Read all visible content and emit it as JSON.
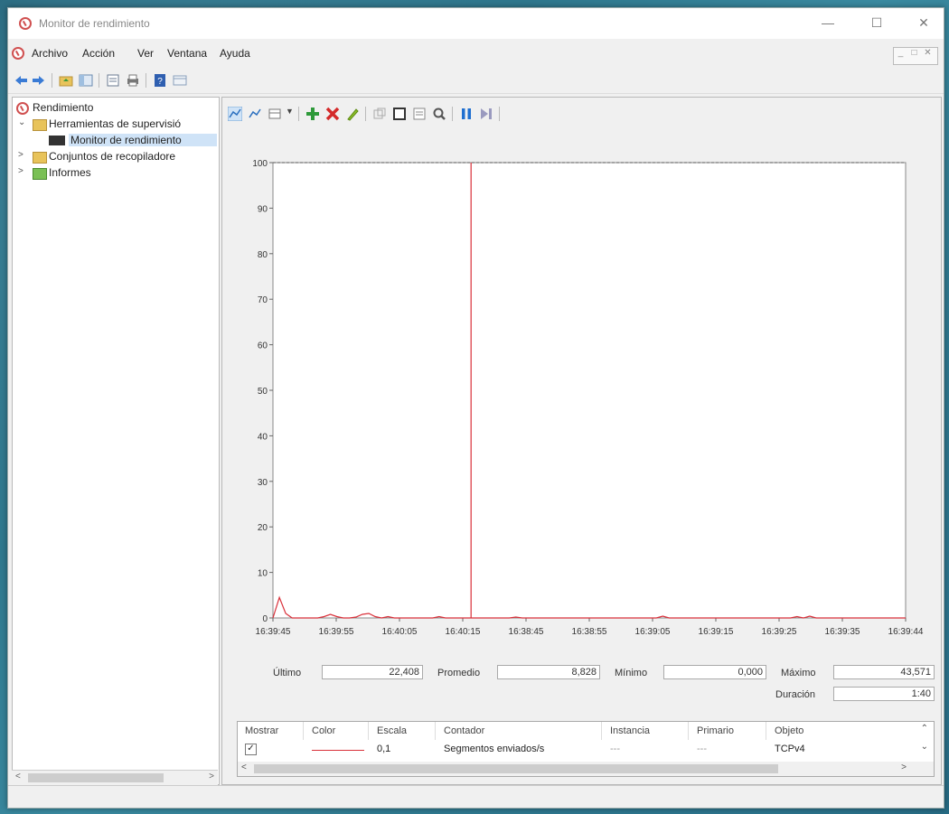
{
  "window": {
    "title": "Monitor de rendimiento"
  },
  "menu": {
    "items": [
      "Archivo",
      "Acción",
      "Ver",
      "Ventana",
      "Ayuda"
    ]
  },
  "tree": {
    "root": "Rendimiento",
    "tools": "Herramientas de supervisió",
    "monitor": "Monitor de rendimiento",
    "collectors": "Conjuntos de recopiladore",
    "reports": "Informes"
  },
  "chart_data": {
    "type": "line",
    "y_ticks": [
      0,
      10,
      20,
      30,
      40,
      50,
      60,
      70,
      80,
      90,
      100
    ],
    "ylim": [
      0,
      100
    ],
    "x_tick_labels": [
      "16:39:45",
      "16:39:55",
      "16:40:05",
      "16:40:15",
      "16:38:45",
      "16:38:55",
      "16:39:05",
      "16:39:15",
      "16:39:25",
      "16:39:35",
      "16:39:44"
    ],
    "grid": false,
    "series": [
      {
        "color": "#d9303a",
        "values": [
          0,
          4.5,
          1,
          0,
          0,
          0,
          0,
          0,
          0.3,
          0.8,
          0.3,
          0,
          0,
          0.2,
          0.8,
          1,
          0.3,
          0,
          0.3,
          0,
          0,
          0,
          0,
          0,
          0,
          0,
          0.3,
          0,
          0,
          0,
          0,
          0,
          0,
          0,
          0,
          0,
          0,
          0,
          0.2,
          0,
          0,
          0,
          0,
          0,
          0,
          0,
          0,
          0,
          0,
          0,
          0,
          0,
          0,
          0,
          0,
          0,
          0,
          0,
          0,
          0,
          0,
          0.4,
          0,
          0,
          0,
          0,
          0,
          0,
          0,
          0,
          0,
          0,
          0,
          0,
          0,
          0,
          0,
          0,
          0,
          0,
          0,
          0,
          0.3,
          0,
          0.4,
          0,
          0,
          0,
          0,
          0,
          0,
          0,
          0,
          0,
          0,
          0,
          0,
          0,
          0,
          0
        ]
      }
    ],
    "time_bar_index": 31
  },
  "stats": {
    "last_label": "Último",
    "last_value": "22,408",
    "avg_label": "Promedio",
    "avg_value": "8,828",
    "min_label": "Mínimo",
    "min_value": "0,000",
    "max_label": "Máximo",
    "max_value": "43,571",
    "dur_label": "Duración",
    "dur_value": "1:40"
  },
  "legend": {
    "headers": [
      "Mostrar",
      "Color",
      "Escala",
      "Contador",
      "Instancia",
      "Primario",
      "Objeto"
    ],
    "row": {
      "show": true,
      "scale": "0,1",
      "counter": "Segmentos enviados/s",
      "instance": "---",
      "parent": "---",
      "object": "TCPv4"
    }
  }
}
